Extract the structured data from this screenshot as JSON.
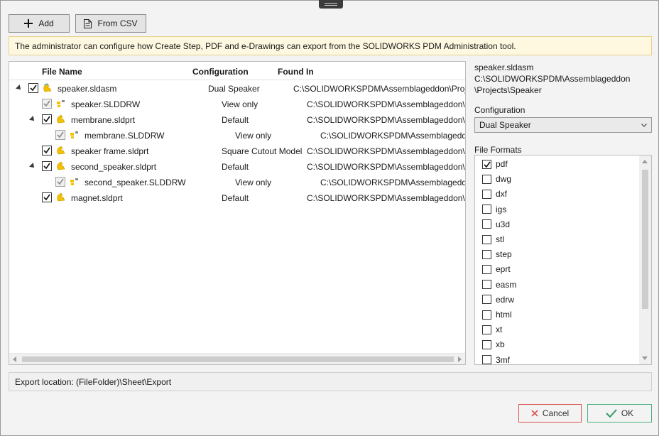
{
  "toolbar": {
    "add_label": "Add",
    "from_csv_label": "From CSV"
  },
  "banner": {
    "text": "The administrator can configure how Create Step, PDF and e-Drawings can export from the SOLIDWORKS PDM Administration tool."
  },
  "table": {
    "headers": {
      "file_name": "File Name",
      "configuration": "Configuration",
      "found_in": "Found In"
    },
    "rows": [
      {
        "name": "speaker.sldasm",
        "config": "Dual Speaker",
        "found": "C:\\SOLIDWORKSPDM\\Assemblageddon\\Projects\\Speaker",
        "level": 0,
        "expander": true,
        "checked": true,
        "disabled": false,
        "icon": "assembly-icon"
      },
      {
        "name": "speaker.SLDDRW",
        "config": "View only",
        "found": "C:\\SOLIDWORKSPDM\\Assemblageddon\\Projects\\Speaker",
        "level": 1,
        "expander": false,
        "checked": true,
        "disabled": true,
        "icon": "drawing-icon"
      },
      {
        "name": "membrane.sldprt",
        "config": "Default",
        "found": "C:\\SOLIDWORKSPDM\\Assemblageddon\\Projects\\Speaker",
        "level": 1,
        "expander": true,
        "checked": true,
        "disabled": false,
        "icon": "part-icon"
      },
      {
        "name": "membrane.SLDDRW",
        "config": "View only",
        "found": "C:\\SOLIDWORKSPDM\\Assemblageddon\\Projects\\Speaker",
        "level": 2,
        "expander": false,
        "checked": true,
        "disabled": true,
        "icon": "drawing-icon"
      },
      {
        "name": "speaker frame.sldprt",
        "config": "Square Cutout Model",
        "found": "C:\\SOLIDWORKSPDM\\Assemblageddon\\Projects\\Speaker",
        "level": 1,
        "expander": false,
        "checked": true,
        "disabled": false,
        "icon": "part-icon"
      },
      {
        "name": "second_speaker.sldprt",
        "config": "Default",
        "found": "C:\\SOLIDWORKSPDM\\Assemblageddon\\Projects\\Speaker",
        "level": 1,
        "expander": true,
        "checked": true,
        "disabled": false,
        "icon": "part-icon"
      },
      {
        "name": "second_speaker.SLDDRW",
        "config": "View only",
        "found": "C:\\SOLIDWORKSPDM\\Assemblageddon\\Projects\\Speaker",
        "level": 2,
        "expander": false,
        "checked": true,
        "disabled": true,
        "icon": "drawing-icon"
      },
      {
        "name": "magnet.sldprt",
        "config": "Default",
        "found": "C:\\SOLIDWORKSPDM\\Assemblageddon\\Projects\\Speaker",
        "level": 1,
        "expander": false,
        "checked": true,
        "disabled": false,
        "icon": "part-icon"
      }
    ]
  },
  "details": {
    "file_name": "speaker.sldasm",
    "path_line1": "C:\\SOLIDWORKSPDM\\Assemblageddon",
    "path_line2": "\\Projects\\Speaker",
    "configuration_label": "Configuration",
    "configuration_value": "Dual Speaker",
    "file_formats_label": "File Formats",
    "formats": [
      {
        "label": "pdf",
        "checked": true
      },
      {
        "label": "dwg",
        "checked": false
      },
      {
        "label": "dxf",
        "checked": false
      },
      {
        "label": "igs",
        "checked": false
      },
      {
        "label": "u3d",
        "checked": false
      },
      {
        "label": "stl",
        "checked": false
      },
      {
        "label": "step",
        "checked": false
      },
      {
        "label": "eprt",
        "checked": false
      },
      {
        "label": "easm",
        "checked": false
      },
      {
        "label": "edrw",
        "checked": false
      },
      {
        "label": "html",
        "checked": false
      },
      {
        "label": "xt",
        "checked": false
      },
      {
        "label": "xb",
        "checked": false
      },
      {
        "label": "3mf",
        "checked": false
      }
    ]
  },
  "export": {
    "text": "Export location: (FileFolder)\\Sheet\\Export"
  },
  "dialog": {
    "cancel_label": "Cancel",
    "ok_label": "OK"
  },
  "colors": {
    "banner_bg": "#fff8e1",
    "cancel_accent": "#d9534f",
    "ok_accent": "#2e9c63",
    "part_icon": "#f2c200"
  }
}
